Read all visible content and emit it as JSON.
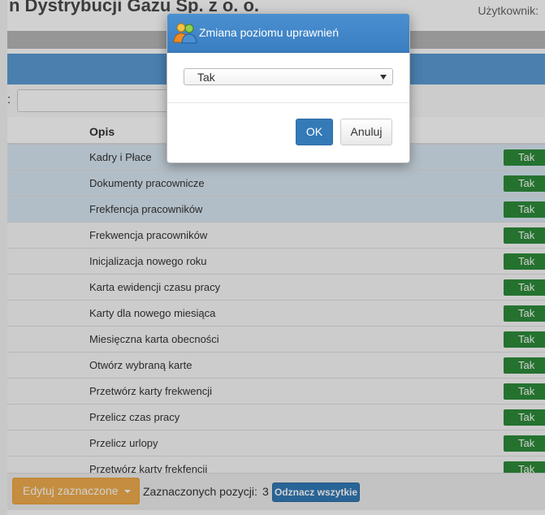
{
  "page": {
    "title": "n Dystrybucji Gazu Sp. z o. o.",
    "user_label": "Użytkownik:"
  },
  "filter": {
    "label": ":"
  },
  "table": {
    "header_opis": "Opis",
    "rows": [
      {
        "label": "Kadry i Płace",
        "value": "Tak",
        "selected": true
      },
      {
        "label": "Dokumenty pracownicze",
        "value": "Tak",
        "selected": true
      },
      {
        "label": "Frekfencja pracowników",
        "value": "Tak",
        "selected": true
      },
      {
        "label": "Frekwencja pracowników",
        "value": "Tak",
        "selected": false
      },
      {
        "label": "Inicjalizacja nowego roku",
        "value": "Tak",
        "selected": false
      },
      {
        "label": "Karta ewidencji czasu pracy",
        "value": "Tak",
        "selected": false
      },
      {
        "label": "Karty dla nowego miesiąca",
        "value": "Tak",
        "selected": false
      },
      {
        "label": "Miesięczna karta obecności",
        "value": "Tak",
        "selected": false
      },
      {
        "label": "Otwórz wybraną karte",
        "value": "Tak",
        "selected": false
      },
      {
        "label": "Przetwórz karty frekwencji",
        "value": "Tak",
        "selected": false
      },
      {
        "label": "Przelicz czas pracy",
        "value": "Tak",
        "selected": false
      },
      {
        "label": "Przelicz urlopy",
        "value": "Tak",
        "selected": false
      },
      {
        "label": "Przetwórz karty frekfencji",
        "value": "Tak",
        "selected": false
      }
    ]
  },
  "footer": {
    "edit_label": "Edytuj zaznaczone",
    "selected_label": "Zaznaczonych pozycji:",
    "selected_count": "3",
    "unmark_label": "Odznacz wszytkie"
  },
  "modal": {
    "title": "Zmiana poziomu uprawnień",
    "icon": "users-icon",
    "select_value": "Tak",
    "ok_label": "OK",
    "cancel_label": "Anuluj"
  },
  "colors": {
    "accent_blue": "#337ab7",
    "badge_green": "#2e8b3a",
    "edit_orange": "#f0ad4e",
    "selected_row": "#d9e8f3"
  }
}
